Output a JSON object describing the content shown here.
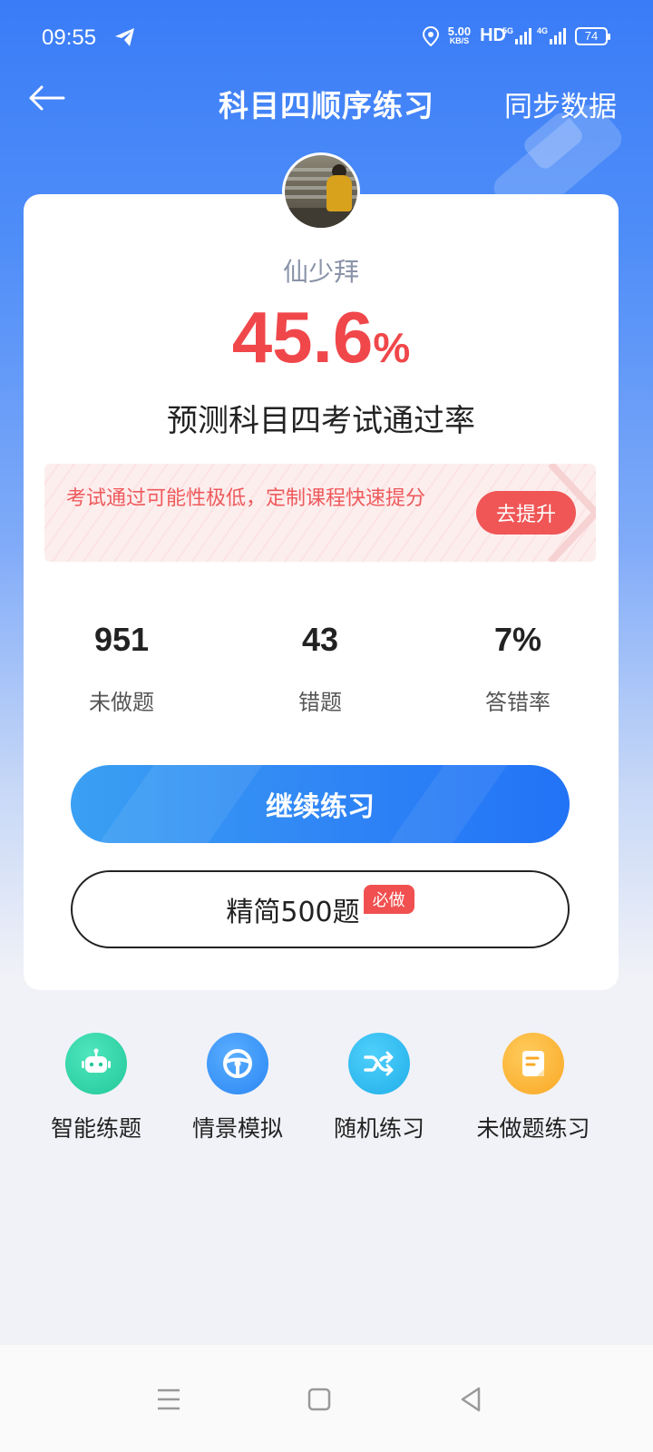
{
  "status_bar": {
    "time": "09:55",
    "net_speed_value": "5.00",
    "net_speed_unit": "KB/S",
    "hd": "HD",
    "sig1": "5G",
    "sig2": "4G",
    "battery": "74"
  },
  "header": {
    "title": "科目四顺序练习",
    "sync_label": "同步数据"
  },
  "card": {
    "username": "仙少拜",
    "pass_rate_value": "45.6",
    "pass_rate_unit": "%",
    "pass_rate_label": "预测科目四考试通过率",
    "banner_text": "考试通过可能性极低，定制课程快速提分",
    "banner_button": "去提升",
    "stats": [
      {
        "value": "951",
        "label": "未做题"
      },
      {
        "value": "43",
        "label": "错题"
      },
      {
        "value": "7%",
        "label": "答错率"
      }
    ],
    "continue_button": "继续练习",
    "simple_button": "精简500题",
    "simple_badge": "必做"
  },
  "quick_actions": [
    {
      "label": "智能练题",
      "icon": "robot-icon",
      "color": "#2fd3a6"
    },
    {
      "label": "情景模拟",
      "icon": "steering-wheel-icon",
      "color": "#2f8ff5"
    },
    {
      "label": "随机练习",
      "icon": "shuffle-icon",
      "color": "#29b6f0"
    },
    {
      "label": "未做题练习",
      "icon": "document-icon",
      "color": "#fbb13c"
    }
  ],
  "colors": {
    "accent_red": "#f0474b",
    "primary_blue": "#2f84f5"
  }
}
